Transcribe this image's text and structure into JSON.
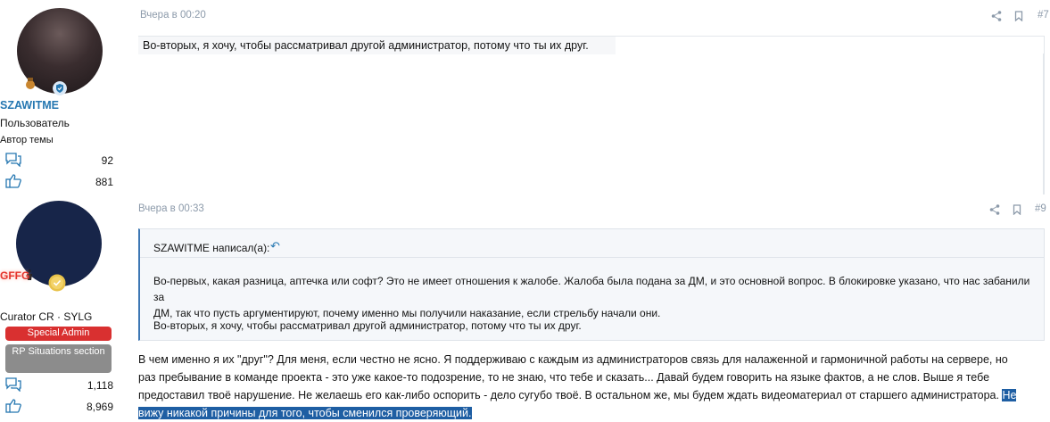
{
  "posts": [
    {
      "username": "SZAWITME",
      "user_title": "Пользователь",
      "user_extra": "Автор темы",
      "messages_count": "92",
      "reactions_count": "881",
      "time": "Вчера в 00:20",
      "post_number": "#7",
      "text": "Во-вторых, я хочу, чтобы рассматривал другой администратор, потому что ты их друг."
    },
    {
      "username": "GFFG",
      "user_title": "Curator CR · SYLG",
      "banner_1": "Special Admin",
      "banner_2": "RP Situations section",
      "messages_count": "1,118",
      "reactions_count": "8,969",
      "time": "Вчера в 00:33",
      "post_number": "#9",
      "quote": {
        "author": "SZAWITME написал(а):",
        "jump_icon": "reply-arrow-icon",
        "paragraph_1_line_1": "Во-первых, какая разница, аптечка или софт? Это не имеет отношения к жалобе. Жалоба была подана за ДМ, и это основной вопрос. В блокировке указано, что нас забанили за",
        "paragraph_1_line_2": "ДМ, так что пусть аргументируют, почему именно мы получили наказание, если стрельбу начали они.",
        "paragraph_2": "Во-вторых, я хочу, чтобы рассматривал другой администратор, потому что ты их друг."
      },
      "body": {
        "line_1": "В чем именно я их \"друг\"? Для меня, если честно не ясно. Я поддерживаю с каждым из администраторов связь для налаженной и гармоничной работы на сервере, но",
        "line_2": "раз пребывание в команде проекта - это уже какое-то подозрение, то не знаю, что тебе и сказать... Давай будем говорить на языке фактов, а не слов. Выше я тебе",
        "line_3_plain": "предоставил твоё нарушение. Не желаешь его как-либо оспорить - дело сугубо твоё. В остальном же, мы будем ждать видеоматериал от старшего администратора.",
        "line_3_selected": "Не",
        "line_4_selected": "вижу никакой причины для того, чтобы сменился проверяющий."
      }
    }
  ],
  "icons": {
    "share": "share-icon",
    "bookmark": "bookmark-icon",
    "messages": "messages-icon",
    "likes": "thumbs-up-icon"
  },
  "colors": {
    "accent": "#2577b1",
    "special_admin": "#d93030",
    "selection": "#1e5ea3"
  }
}
